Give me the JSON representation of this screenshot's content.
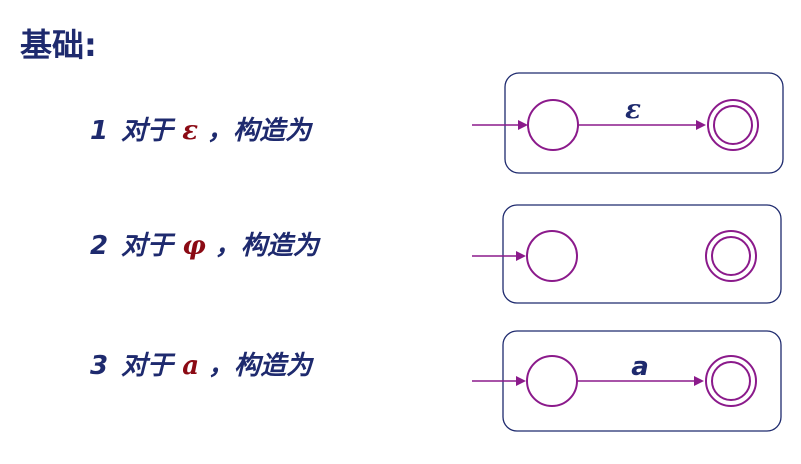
{
  "heading": "基础:",
  "rules": [
    {
      "number": "1",
      "prefix": "对于",
      "symbol": "ε",
      "suffix": "，构造为",
      "transition_label": "ε"
    },
    {
      "number": "2",
      "prefix": "对于",
      "symbol": "φ",
      "suffix": "，构造为",
      "transition_label": ""
    },
    {
      "number": "3",
      "prefix": "对于",
      "symbol": "a",
      "suffix": "，构造为",
      "transition_label": "a"
    }
  ],
  "colors": {
    "text": "#1e2a6e",
    "symbol": "#8b0a14",
    "state": "#8b1a8b"
  }
}
